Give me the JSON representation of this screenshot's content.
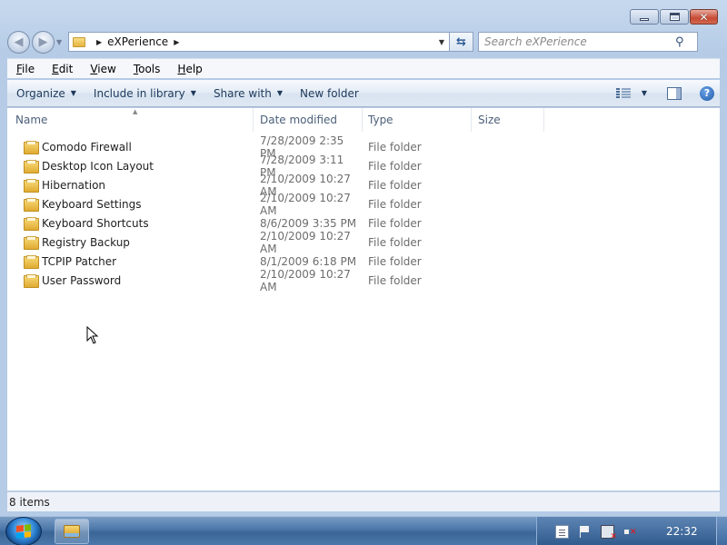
{
  "window": {
    "caption_buttons": {
      "minimize": "minimize",
      "maximize": "maximize",
      "close": "close"
    }
  },
  "address": {
    "crumbs": [
      "eXPerience"
    ]
  },
  "search": {
    "placeholder": "Search eXPerience"
  },
  "menu": [
    {
      "accel": "F",
      "rest": "ile"
    },
    {
      "accel": "E",
      "rest": "dit"
    },
    {
      "accel": "V",
      "rest": "iew"
    },
    {
      "accel": "T",
      "rest": "ools"
    },
    {
      "accel": "H",
      "rest": "elp"
    }
  ],
  "commands": {
    "organize": "Organize",
    "include_in_library": "Include in library",
    "share_with": "Share with",
    "new_folder": "New folder"
  },
  "columns": {
    "name": "Name",
    "date_modified": "Date modified",
    "type": "Type",
    "size": "Size"
  },
  "files": [
    {
      "name": "Comodo Firewall",
      "date": "7/28/2009 2:35 PM",
      "type": "File folder"
    },
    {
      "name": "Desktop Icon Layout",
      "date": "7/28/2009 3:11 PM",
      "type": "File folder"
    },
    {
      "name": "Hibernation",
      "date": "2/10/2009 10:27 AM",
      "type": "File folder"
    },
    {
      "name": "Keyboard Settings",
      "date": "2/10/2009 10:27 AM",
      "type": "File folder"
    },
    {
      "name": "Keyboard Shortcuts",
      "date": "8/6/2009 3:35 PM",
      "type": "File folder"
    },
    {
      "name": "Registry Backup",
      "date": "2/10/2009 10:27 AM",
      "type": "File folder"
    },
    {
      "name": "TCPIP Patcher",
      "date": "8/1/2009 6:18 PM",
      "type": "File folder"
    },
    {
      "name": "User Password",
      "date": "2/10/2009 10:27 AM",
      "type": "File folder"
    }
  ],
  "status": {
    "item_count": "8 items"
  },
  "taskbar": {
    "clock": "22:32"
  },
  "icons": {
    "back": "back-arrow-icon",
    "forward": "forward-arrow-icon",
    "folder": "folder-icon",
    "refresh": "refresh-icon",
    "search": "magnifier-icon",
    "help": "help-icon"
  }
}
